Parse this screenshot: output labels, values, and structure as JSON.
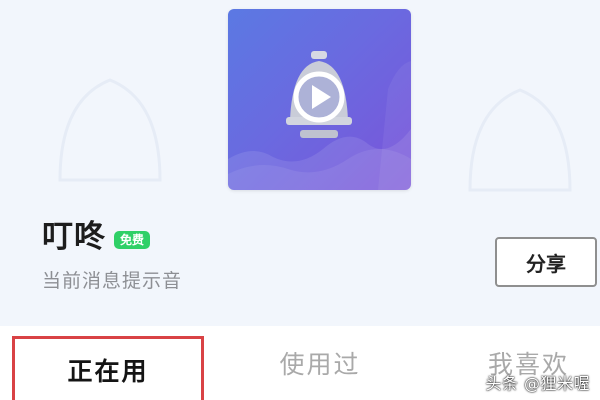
{
  "ringtone": {
    "title": "叮咚",
    "badge": "免费",
    "subtitle": "当前消息提示音"
  },
  "actions": {
    "share_label": "分享"
  },
  "tabs": [
    {
      "label": "正在用",
      "active": true
    },
    {
      "label": "使用过",
      "active": false
    },
    {
      "label": "我喜欢",
      "active": false
    }
  ],
  "watermark": "头条 @狸米喔",
  "colors": {
    "badge_green": "#2fd067",
    "active_tab_border": "#d94245",
    "cover_gradient_start": "#5b79e3",
    "cover_gradient_end": "#7a54d9",
    "panel_background": "#f2f6fc"
  },
  "icons": {
    "cover": "bell-play-icon"
  }
}
